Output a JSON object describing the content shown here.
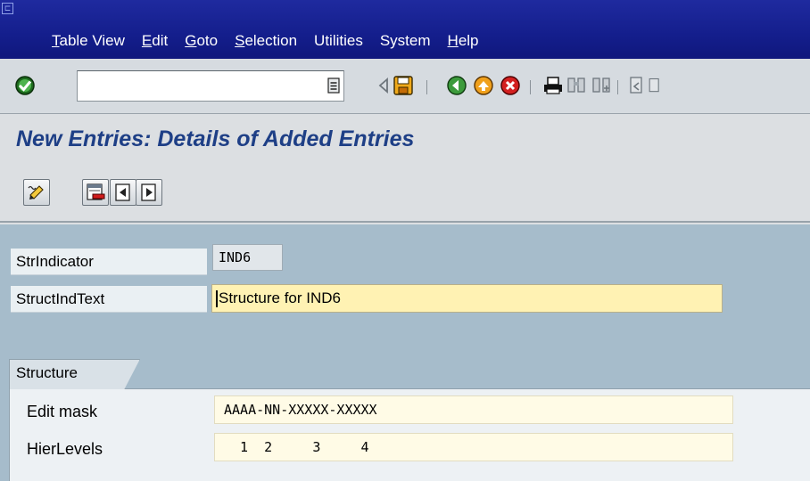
{
  "menu": {
    "items": [
      "Table View",
      "Edit",
      "Goto",
      "Selection",
      "Utilities",
      "System",
      "Help"
    ],
    "mnemonics": [
      "T",
      "E",
      "G",
      "S",
      "",
      "",
      "H"
    ]
  },
  "toolbar": {
    "command_field_value": "",
    "icons": [
      "enter-icon",
      "history-dropdown-icon",
      "back-arrow-icon",
      "save-icon",
      "back-icon",
      "exit-icon",
      "cancel-icon",
      "print-icon",
      "find-icon",
      "find-next-icon",
      "first-page-icon"
    ]
  },
  "page": {
    "title": "New Entries: Details of Added Entries"
  },
  "app_toolbar": {
    "icons": [
      "change-display-icon",
      "delete-icon",
      "previous-entry-icon",
      "next-entry-icon"
    ]
  },
  "form": {
    "str_indicator_label": "StrIndicator",
    "str_indicator_value": "IND6",
    "struct_ind_text_label": "StructIndText",
    "struct_ind_text_value": "Structure for IND6"
  },
  "structure": {
    "tab_label": "Structure",
    "edit_mask_label": "Edit mask",
    "edit_mask_value": "AAAA-NN-XXXXX-XXXXX",
    "hier_levels_label": "HierLevels",
    "hier_levels_value": "  1  2     3     4"
  },
  "colors": {
    "title_bar": "#141e8c",
    "title_text": "#1e3f86",
    "content_bg": "#a6bccb",
    "input_yellow": "#fff2b3"
  }
}
